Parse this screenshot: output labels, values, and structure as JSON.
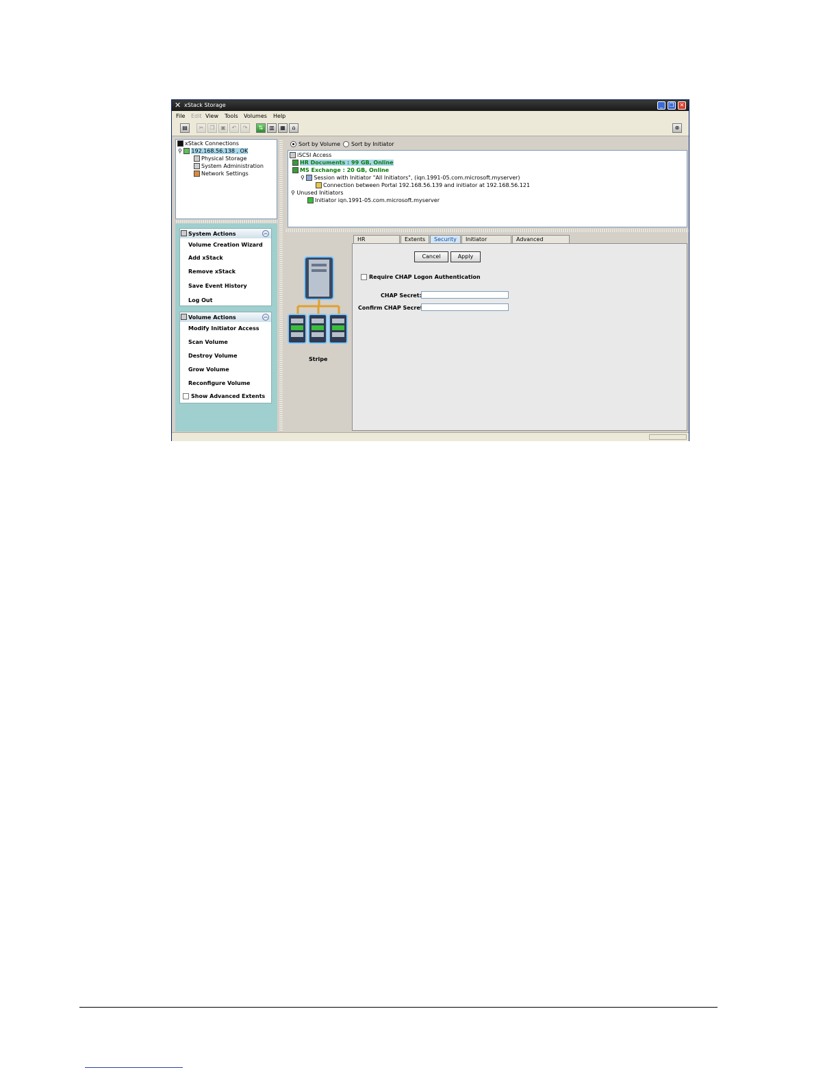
{
  "window": {
    "title": "xStack Storage",
    "menu": [
      "File",
      "Edit",
      "View",
      "Tools",
      "Volumes",
      "Help"
    ]
  },
  "tree": {
    "root": "xStack Connections",
    "host": "192.168.56.138 , OK",
    "children": [
      "Physical Storage",
      "System Administration",
      "Network Settings"
    ]
  },
  "sort": {
    "by_volume": "Sort by Volume",
    "by_initiator": "Sort by Initiator"
  },
  "iscsi": {
    "root": "iSCSI Access",
    "vol1": "HR Documents : 99 GB, Online",
    "vol2": "MS Exchange : 20 GB, Online",
    "session": "Session with Initiator \"All Initiators\", (iqn.1991-05.com.microsoft.myserver)",
    "connection": "Connection between Portal 192.168.56.139 and initiator at  192.168.56.121",
    "unused": "Unused Initiators",
    "initiator": "Initiator iqn.1991-05.com.microsoft.myserver"
  },
  "system_actions": {
    "title": "System Actions",
    "items": [
      "Volume Creation Wizard",
      "Add xStack",
      "Remove xStack",
      "Save Event History",
      "Log Out"
    ]
  },
  "volume_actions": {
    "title": "Volume Actions",
    "items": [
      "Modify Initiator Access",
      "Scan Volume",
      "Destroy Volume",
      "Grow Volume",
      "Reconfigure Volume"
    ],
    "show_advanced": "Show Advanced Extents"
  },
  "image_caption": "Stripe",
  "tabs": [
    "HR Documents",
    "Extents",
    "Security",
    "Initiator Access",
    "Advanced Settings"
  ],
  "security": {
    "cancel": "Cancel",
    "apply": "Apply",
    "require_chap": "Require CHAP Logon Authentication",
    "chap_secret_label": "CHAP Secret:",
    "confirm_chap_label": "Confirm CHAP Secret:",
    "chap_secret_value": "",
    "confirm_chap_value": ""
  }
}
